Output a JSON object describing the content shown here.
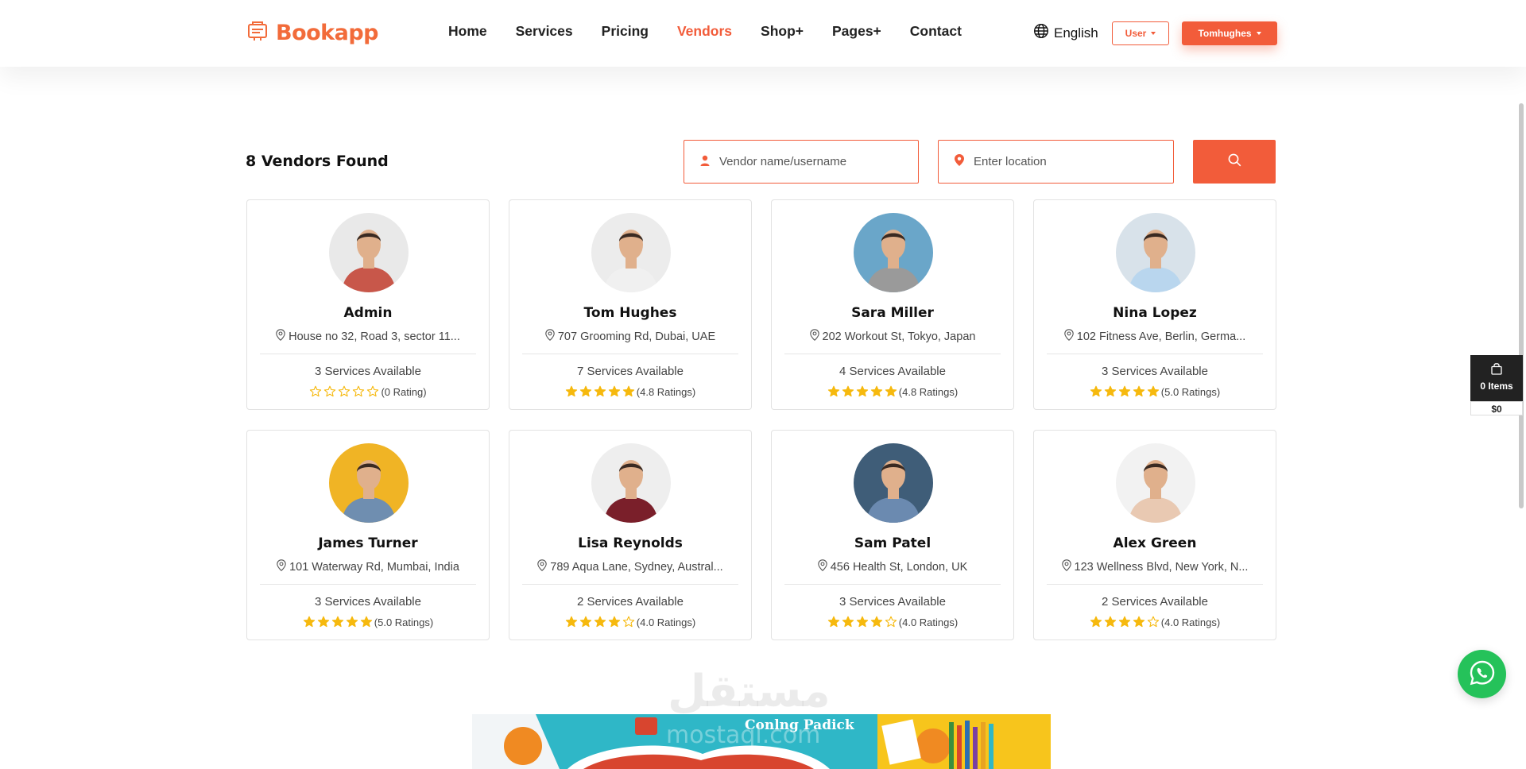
{
  "brand": {
    "name": "Bookapp",
    "accent": "#f25c3a"
  },
  "nav": {
    "items": [
      {
        "label": "Home"
      },
      {
        "label": "Services"
      },
      {
        "label": "Pricing"
      },
      {
        "label": "Vendors",
        "active": true
      },
      {
        "label": "Shop+"
      },
      {
        "label": "Pages+"
      },
      {
        "label": "Contact"
      }
    ]
  },
  "header": {
    "language": "English",
    "user_button": "User",
    "account_button": "Tomhughes"
  },
  "search": {
    "results_label": "8 Vendors Found",
    "name_placeholder": "Vendor name/username",
    "location_placeholder": "Enter location"
  },
  "vendors": [
    {
      "name": "Admin",
      "address": "House no 32, Road 3, sector 11...",
      "services": "3 Services Available",
      "rating": 0,
      "rating_label": "(0 Rating)",
      "avatar_bg": "#e9e9e9",
      "shirt": "#c8574a"
    },
    {
      "name": "Tom Hughes",
      "address": "707 Grooming Rd, Dubai, UAE",
      "services": "7 Services Available",
      "rating": 5,
      "rating_label": "(4.8 Ratings)",
      "avatar_bg": "#ececec",
      "shirt": "#f0f0f0"
    },
    {
      "name": "Sara Miller",
      "address": "202 Workout St, Tokyo, Japan",
      "services": "4 Services Available",
      "rating": 5,
      "rating_label": "(4.8 Ratings)",
      "avatar_bg": "#6aa6c9",
      "shirt": "#9a9a9a"
    },
    {
      "name": "Nina Lopez",
      "address": "102 Fitness Ave, Berlin, Germa...",
      "services": "3 Services Available",
      "rating": 5,
      "rating_label": "(5.0 Ratings)",
      "avatar_bg": "#d8e2ea",
      "shirt": "#b9d6ee"
    },
    {
      "name": "James Turner",
      "address": "101 Waterway Rd, Mumbai, India",
      "services": "3 Services Available",
      "rating": 5,
      "rating_label": "(5.0 Ratings)",
      "avatar_bg": "#f0b425",
      "shirt": "#6f8eb0"
    },
    {
      "name": "Lisa Reynolds",
      "address": "789 Aqua Lane, Sydney, Austral...",
      "services": "2 Services Available",
      "rating": 4,
      "rating_label": "(4.0 Ratings)",
      "avatar_bg": "#eeeeee",
      "shirt": "#7a1f2a"
    },
    {
      "name": "Sam Patel",
      "address": "456 Health St, London, UK",
      "services": "3 Services Available",
      "rating": 4,
      "rating_label": "(4.0 Ratings)",
      "avatar_bg": "#3f5d78",
      "shirt": "#6b8ab0"
    },
    {
      "name": "Alex Green",
      "address": "123 Wellness Blvd, New York, N...",
      "services": "2 Services Available",
      "rating": 4,
      "rating_label": "(4.0 Ratings)",
      "avatar_bg": "#f2f2f2",
      "shirt": "#e9c9b2"
    }
  ],
  "cart": {
    "items_label": "0 Items",
    "total": "$0"
  },
  "banner": {
    "title": "Conlng Padick"
  },
  "watermark": {
    "text": "مستقل",
    "url": "mostaql.com"
  },
  "colors": {
    "star": "#f6b90e",
    "star_empty": "#f6b90e",
    "skin": "#e0b08c"
  }
}
